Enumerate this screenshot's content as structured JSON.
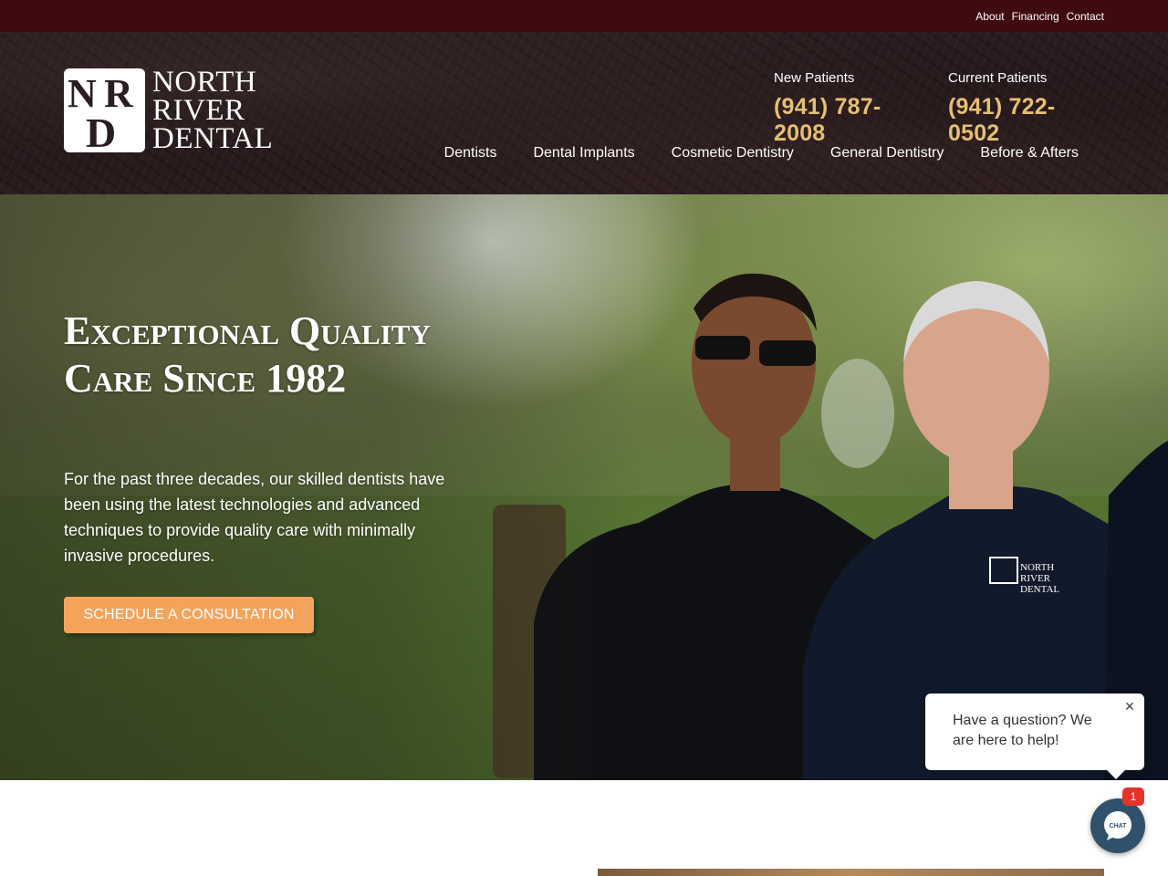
{
  "topbar": {
    "links": [
      "About",
      "Financing",
      "Contact"
    ]
  },
  "brand": {
    "name_lines": [
      "North",
      "River",
      "Dental"
    ],
    "monogram": "NRD",
    "colors": {
      "topbar": "#3f0b10",
      "phone": "#e6bf72",
      "cta": "#f3a45a",
      "chat": "#30516b"
    }
  },
  "phones": [
    {
      "label": "New Patients",
      "number": "(941) 787-2008"
    },
    {
      "label": "Current Patients",
      "number": "(941) 722-0502"
    }
  ],
  "nav": [
    "Dentists",
    "Dental Implants",
    "Cosmetic Dentistry",
    "General Dentistry",
    "Before & Afters"
  ],
  "hero": {
    "title": "Exceptional Quality Care Since 1982",
    "description": "For the past three decades, our skilled dentists have been using the latest technologies and advanced techniques to provide quality care with minimally invasive procedures.",
    "cta_label": "SCHEDULE A CONSULTATION"
  },
  "chat": {
    "message": "Have a question? We are here to help!",
    "launcher_text": "CHAT",
    "badge_count": "1",
    "close_icon": "close-icon"
  }
}
